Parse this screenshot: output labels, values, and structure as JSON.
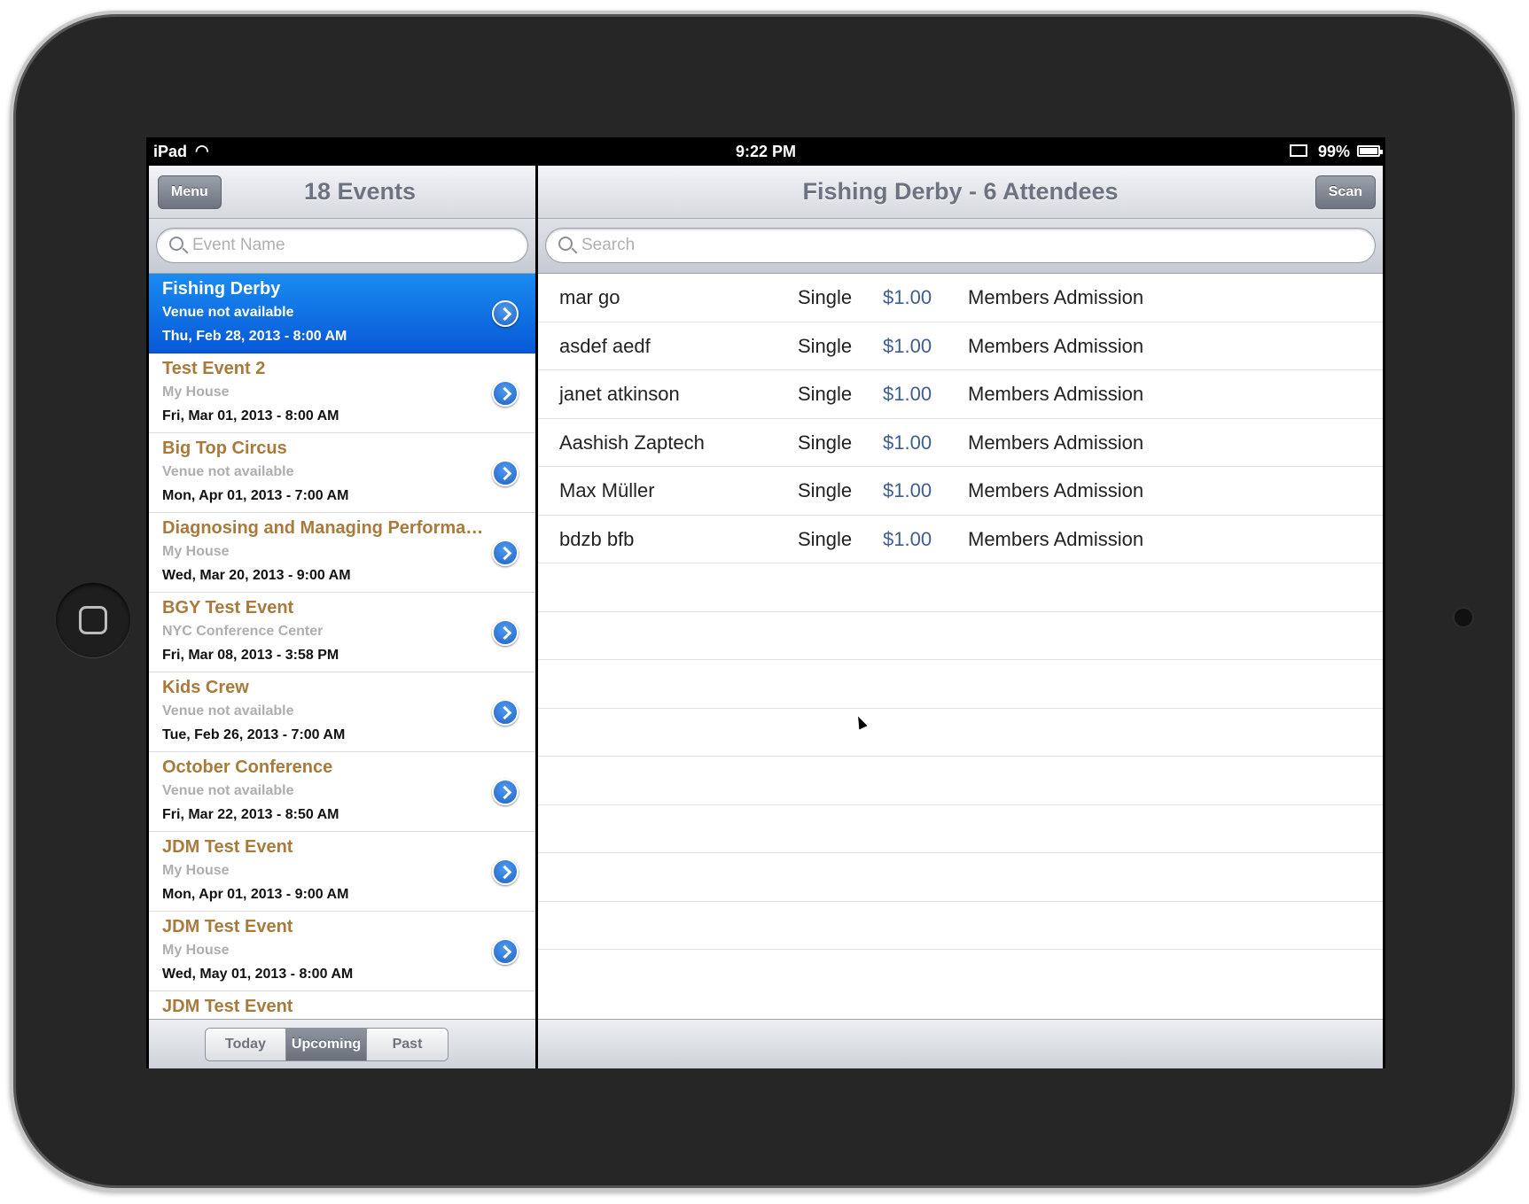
{
  "status_bar": {
    "device": "iPad",
    "time": "9:22 PM",
    "battery": "99%"
  },
  "events_pane": {
    "menu_label": "Menu",
    "title": "18 Events",
    "search_placeholder": "Event Name",
    "events": [
      {
        "name": "Fishing Derby",
        "venue": "Venue not available",
        "date": "Thu, Feb 28, 2013 - 8:00 AM",
        "selected": true
      },
      {
        "name": "Test Event 2",
        "venue": "My House",
        "date": "Fri, Mar 01, 2013 - 8:00 AM"
      },
      {
        "name": "Big Top Circus",
        "venue": "Venue not available",
        "date": "Mon, Apr 01, 2013 - 7:00 AM"
      },
      {
        "name": "Diagnosing and Managing Performa…",
        "venue": "My House",
        "date": "Wed, Mar 20, 2013 - 9:00 AM"
      },
      {
        "name": "BGY Test Event",
        "venue": "NYC Conference Center",
        "date": "Fri, Mar 08, 2013 - 3:58 PM"
      },
      {
        "name": "Kids Crew",
        "venue": "Venue not available",
        "date": "Tue, Feb 26, 2013 - 7:00 AM"
      },
      {
        "name": "October Conference",
        "venue": "Venue not available",
        "date": "Fri, Mar 22, 2013 - 8:50 AM"
      },
      {
        "name": "JDM Test Event",
        "venue": "My House",
        "date": "Mon, Apr 01, 2013 - 9:00 AM"
      },
      {
        "name": "JDM Test Event",
        "venue": "My House",
        "date": "Wed, May 01, 2013 - 8:00 AM"
      },
      {
        "name": "JDM Test Event",
        "venue": "",
        "date": ""
      }
    ],
    "segments": [
      "Today",
      "Upcoming",
      "Past"
    ],
    "active_segment": "Upcoming"
  },
  "attendees_pane": {
    "title": "Fishing Derby - 6 Attendees",
    "scan_label": "Scan",
    "search_placeholder": "Search",
    "attendees": [
      {
        "name": "mar go",
        "type": "Single",
        "price": "$1.00",
        "ticket": "Members Admission"
      },
      {
        "name": "asdef aedf",
        "type": "Single",
        "price": "$1.00",
        "ticket": "Members Admission"
      },
      {
        "name": "janet atkinson",
        "type": "Single",
        "price": "$1.00",
        "ticket": "Members Admission"
      },
      {
        "name": "Aashish Zaptech",
        "type": "Single",
        "price": "$1.00",
        "ticket": "Members Admission"
      },
      {
        "name": "Max Müller",
        "type": "Single",
        "price": "$1.00",
        "ticket": "Members Admission"
      },
      {
        "name": "bdzb bfb",
        "type": "Single",
        "price": "$1.00",
        "ticket": "Members Admission"
      }
    ]
  },
  "colors": {
    "selected_row": "#0a6fe6",
    "event_name": "#a97a3b",
    "price": "#3d5d93"
  }
}
